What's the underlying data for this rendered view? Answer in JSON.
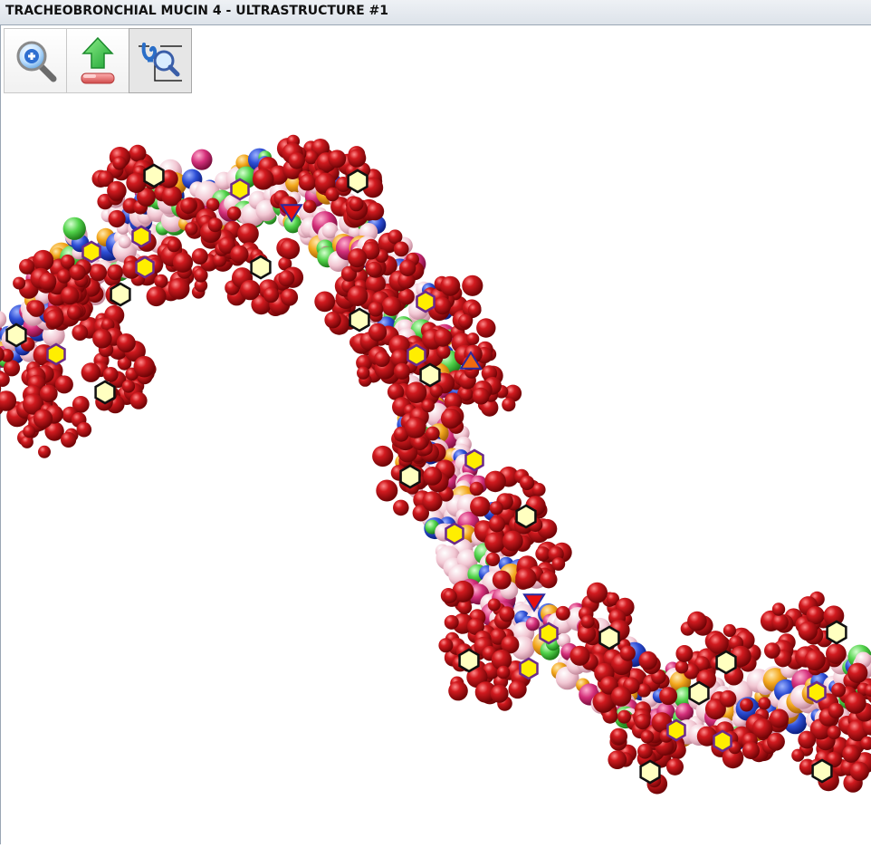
{
  "window": {
    "title": "TRACHEOBRONCHIAL MUCIN 4 - ULTRASTRUCTURE #1"
  },
  "toolbar": {
    "tools": [
      {
        "icon": "zoom-in-icon",
        "active": false
      },
      {
        "icon": "export-upload-icon",
        "active": false
      },
      {
        "icon": "structure-search-icon",
        "active": true
      }
    ]
  },
  "viewer": {
    "content": "3D space-filling molecular model",
    "colors": {
      "glycan_cluster": "#b8141a",
      "glycan_highlight": "#ff6a6a",
      "hexagon_marker_fill": "#ffffc0",
      "hexagon_marker_yellow": "#ffee00",
      "triangle_marker": "#e81010",
      "backbone_pink": "#f2c7d3",
      "backbone_blue": "#2e4fd6",
      "backbone_green": "#52d34b",
      "backbone_orange": "#f3a71c"
    }
  }
}
